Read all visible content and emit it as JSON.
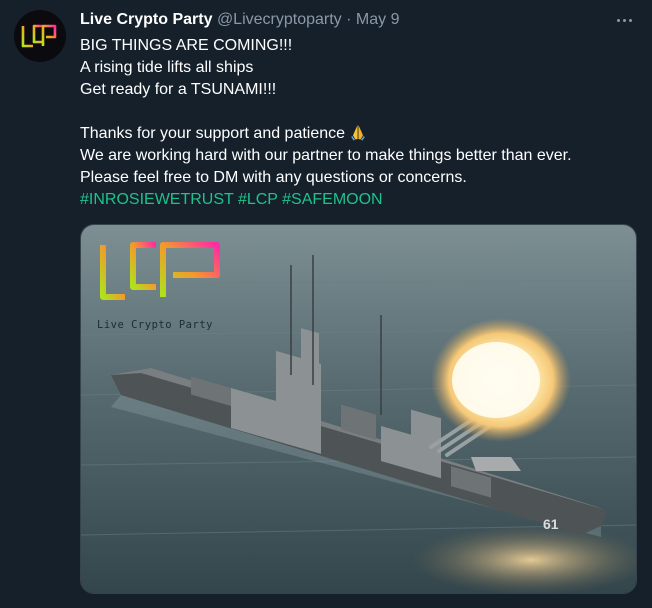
{
  "tweet": {
    "author_name": "Live Crypto Party",
    "handle": "@Livecryptoparty",
    "separator": " · ",
    "date": "May 9",
    "lines": [
      "BIG THINGS ARE COMING!!!",
      "A rising tide lifts all ships",
      "Get ready for a TSUNAMI!!!"
    ],
    "thanks_line": "Thanks for your support and patience",
    "lines2": [
      "We are working hard with our partner to make things better than ever.",
      "Please feel free to DM with any questions or concerns."
    ],
    "hashtags": [
      "#INROSIEWETRUST",
      "#LCP",
      "#SAFEMOON"
    ]
  },
  "media": {
    "logo_caption": "Live Crypto Party",
    "hull_number": "61"
  },
  "icons": {
    "avatar": "lcp-logo-avatar",
    "more": "more-horizontal-icon",
    "emoji": "folded-hands-emoji"
  },
  "colors": {
    "background": "#15202b",
    "hashtag": "#1ec28b",
    "secondary_text": "#8b98a5"
  }
}
